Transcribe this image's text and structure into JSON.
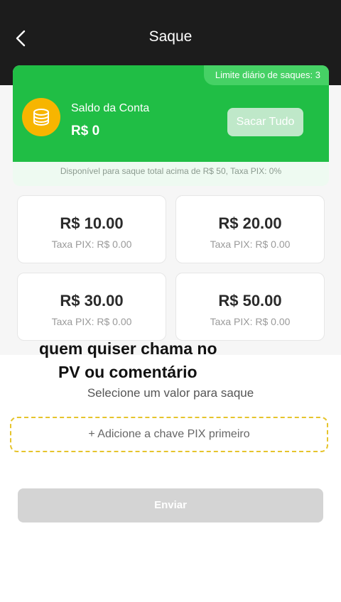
{
  "header": {
    "title": "Saque",
    "back_icon": "chevron-left-icon"
  },
  "balance_card": {
    "limit_badge": "Limite diário de saques: 3",
    "coin_icon": "coin-stack-icon",
    "label": "Saldo da Conta",
    "value": "R$ 0",
    "withdraw_all_label": "Sacar Tudo",
    "note": "Disponível para saque total acima de R$ 50, Taxa PIX: 0%",
    "colors": {
      "card": "#20be45",
      "coin": "#f7b500"
    }
  },
  "amounts": [
    {
      "value": "R$ 10.00",
      "fee": "Taxa PIX: R$ 0.00"
    },
    {
      "value": "R$ 20.00",
      "fee": "Taxa PIX: R$ 0.00"
    },
    {
      "value": "R$ 30.00",
      "fee": "Taxa PIX: R$ 0.00"
    },
    {
      "value": "R$ 50.00",
      "fee": "Taxa PIX: R$ 0.00"
    }
  ],
  "overlay_text": {
    "line1": "quem quiser chama no",
    "line2": "PV ou comentário"
  },
  "select_label": "Selecione um valor para saque",
  "pix_key_prompt": "+ Adicione a chave PIX primeiro",
  "submit_label": "Enviar"
}
